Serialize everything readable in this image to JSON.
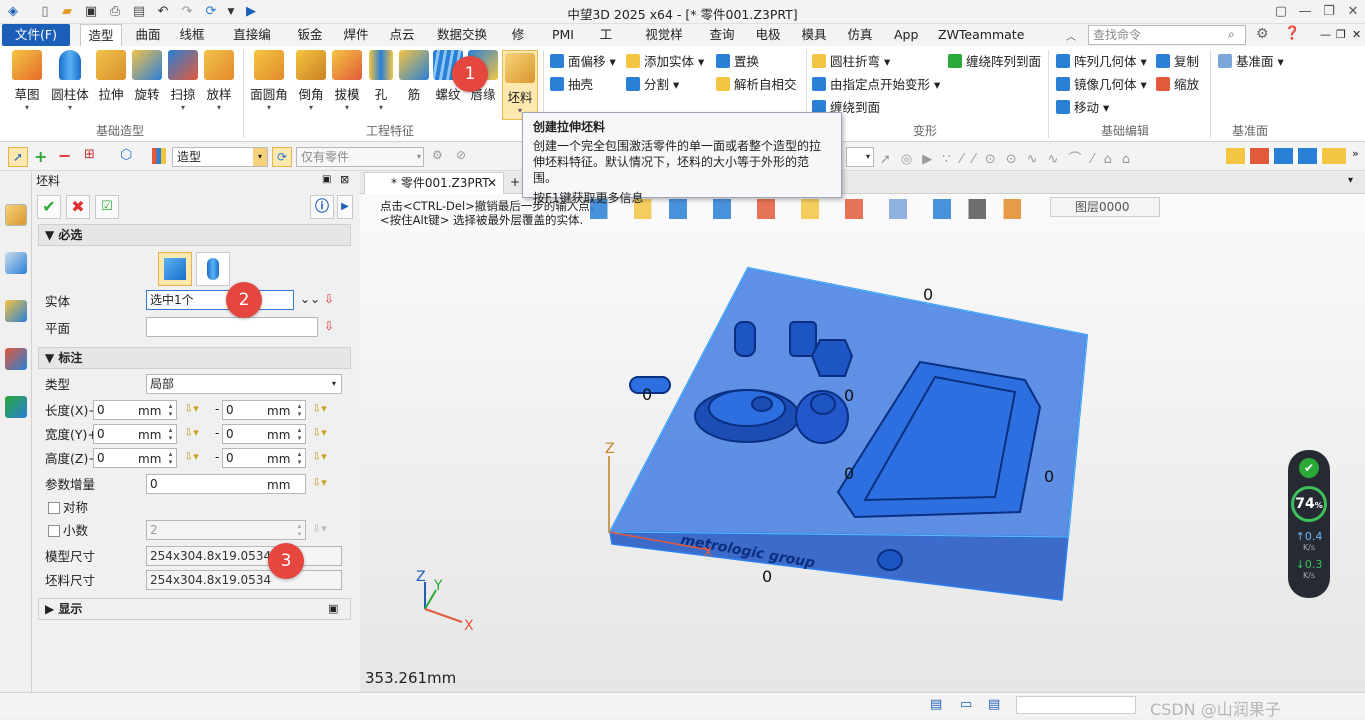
{
  "window": {
    "title": "中望3D 2025 x64 - [* 零件001.Z3PRT]",
    "search_placeholder": "查找命令"
  },
  "menu": {
    "file": "文件(F)",
    "tabs": [
      "造型",
      "曲面",
      "线框",
      "直接编辑",
      "钣金",
      "焊件",
      "点云",
      "数据交换",
      "修复",
      "PMI",
      "工具",
      "视觉样式",
      "查询",
      "电极",
      "模具",
      "仿真",
      "App",
      "ZWTeammate"
    ],
    "active_tab": "造型"
  },
  "ribbon": {
    "basic_buttons": [
      "草图",
      "圆柱体",
      "拉伸",
      "旋转",
      "扫掠",
      "放样"
    ],
    "basic_group": "基础造型",
    "eng_buttons": [
      "面圆角",
      "倒角",
      "拔模",
      "孔",
      "筋",
      "螺纹",
      "唇缘",
      "坯料"
    ],
    "eng_group": "工程特征",
    "edit_col1": [
      "面偏移",
      "抽壳"
    ],
    "edit_col2": [
      "添加实体",
      "分割"
    ],
    "edit_col3": [
      "置换",
      "解析自相交"
    ],
    "deform_col1": [
      "圆柱折弯",
      "由指定点开始变形",
      "缠绕到面"
    ],
    "deform_col2": [
      "缠绕阵列到面"
    ],
    "deform_group": "变形",
    "basic_edit_col1": [
      "阵列几何体",
      "镜像几何体",
      "移动"
    ],
    "basic_edit_col2": [
      "复制",
      "缩放"
    ],
    "basic_edit_group": "基础编辑",
    "datum_button": "基准面",
    "datum_group": "基准面"
  },
  "toolbar2": {
    "mode_combo": "造型",
    "filter_combo": "仅有零件"
  },
  "tooltip": {
    "title": "创建拉伸坯料",
    "body": "创建一个完全包围激活零件的单一面或者整个造型的拉伸坯料特征。默认情况下，坯料的大小等于外形的范围。",
    "hint": "按F1键获取更多信息"
  },
  "panel": {
    "title": "坯料",
    "required_section": "必选",
    "solid_label": "实体",
    "solid_value": "选中1个",
    "plane_label": "平面",
    "annotate_section": "标注",
    "type_label": "类型",
    "type_value": "局部",
    "rows": [
      {
        "label": "长度(X)+",
        "v1": "0",
        "v2": "0",
        "unit": "mm"
      },
      {
        "label": "宽度(Y)+",
        "v1": "0",
        "v2": "0",
        "unit": "mm"
      },
      {
        "label": "高度(Z)+",
        "v1": "0",
        "v2": "0",
        "unit": "mm"
      }
    ],
    "increment_label": "参数增量",
    "increment_value": "0",
    "increment_unit": "mm",
    "symmetric_label": "对称",
    "decimal_label": "小数",
    "decimal_value": "2",
    "model_size_label": "模型尺寸",
    "model_size_value": "254x304.8x19.0534",
    "blank_size_label": "坯料尺寸",
    "blank_size_value": "254x304.8x19.0534",
    "display_section": "显示"
  },
  "viewport": {
    "doc_tab": "* 零件001.Z3PRT",
    "hint1": "点击<CTRL-Del>撤销最后一步的输入点。",
    "hint2": "<按住Alt键> 选择被最外层覆盖的实体.",
    "layer": "图层0000",
    "dim_labels": [
      "0",
      "0",
      "0",
      "0",
      "0",
      "0"
    ],
    "engraving": "metrologic group",
    "scale": "353.261mm",
    "axes": {
      "x": "X",
      "y": "Y",
      "z": "Z"
    }
  },
  "hud": {
    "percent": "74",
    "percent_unit": "%",
    "up": "0.4",
    "down": "0.3",
    "rate_unit": "K/s"
  },
  "badges": [
    "1",
    "2",
    "3"
  ],
  "status": {
    "watermark": "CSDN @山润果子"
  },
  "colors": {
    "accent": "#1c5fb8",
    "badge": "#e5473f",
    "blank": "#2d6fe0",
    "hud": "#252a33",
    "ok_green": "#2aa838"
  }
}
